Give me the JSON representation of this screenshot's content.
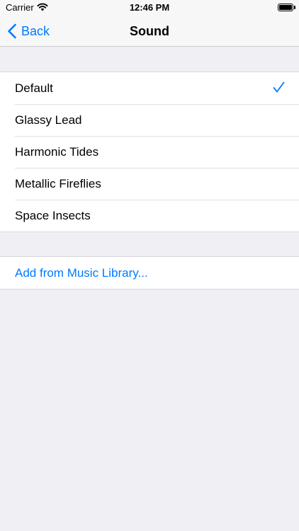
{
  "status_bar": {
    "carrier": "Carrier",
    "time": "12:46 PM"
  },
  "nav": {
    "back_label": "Back",
    "title": "Sound"
  },
  "sounds": [
    {
      "label": "Default",
      "selected": true
    },
    {
      "label": "Glassy Lead",
      "selected": false
    },
    {
      "label": "Harmonic Tides",
      "selected": false
    },
    {
      "label": "Metallic Fireflies",
      "selected": false
    },
    {
      "label": "Space Insects",
      "selected": false
    }
  ],
  "music_library": {
    "label": "Add from Music Library..."
  },
  "colors": {
    "accent": "#007aff",
    "background": "#efeff4"
  }
}
